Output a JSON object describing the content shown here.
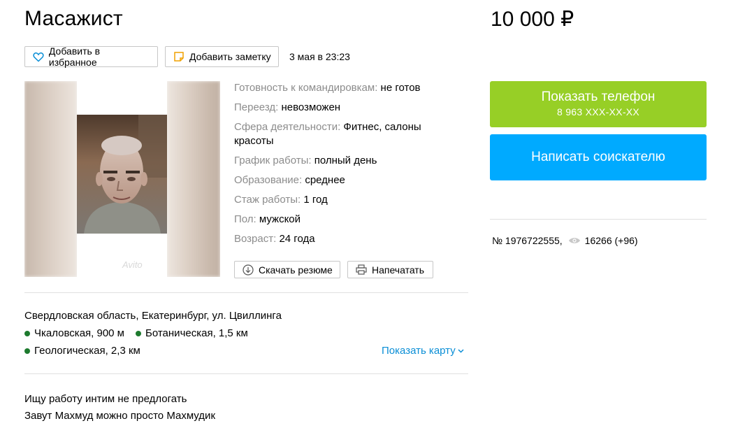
{
  "header": {
    "title": "Масажист",
    "price": "10 000 ₽"
  },
  "actions": {
    "favorite_label": "Добавить в избранное",
    "note_label": "Добавить заметку",
    "date": "3 мая в 23:23"
  },
  "photo": {
    "watermark": "Avito"
  },
  "specs": [
    {
      "key": "Готовность к командировкам:",
      "value": "не готов"
    },
    {
      "key": "Переезд:",
      "value": "невозможен"
    },
    {
      "key": "Сфера деятельности:",
      "value": "Фитнес, салоны красоты"
    },
    {
      "key": "График работы:",
      "value": "полный день"
    },
    {
      "key": "Образование:",
      "value": "среднее"
    },
    {
      "key": "Стаж работы:",
      "value": "1 год"
    },
    {
      "key": "Пол:",
      "value": "мужской"
    },
    {
      "key": "Возраст:",
      "value": "24 года"
    }
  ],
  "files": {
    "resume_label": "Скачать резюме",
    "print_label": "Напечатать"
  },
  "location": {
    "address": "Свердловская область, Екатеринбург, ул. Цвиллинга",
    "metro": [
      {
        "name": "Чкаловская, 900 м"
      },
      {
        "name": "Ботаническая, 1,5 км"
      },
      {
        "name": "Геологическая, 2,3 км"
      }
    ],
    "metro_color": "#1d7a2e",
    "map_link": "Показать карту"
  },
  "description": {
    "line1": "Ищу работу интим не предлогать",
    "line2": "Завут Махмуд можно просто Махмудик"
  },
  "sidebar": {
    "call_label": "Показать телефон",
    "phone_masked": "8 963 XXX-XX-XX",
    "call_color": "#97cf26",
    "write_label": "Написать соискателю",
    "write_color": "#00aaff",
    "ad_number": "№ 1976722555,",
    "views": "16266 (+96)"
  }
}
